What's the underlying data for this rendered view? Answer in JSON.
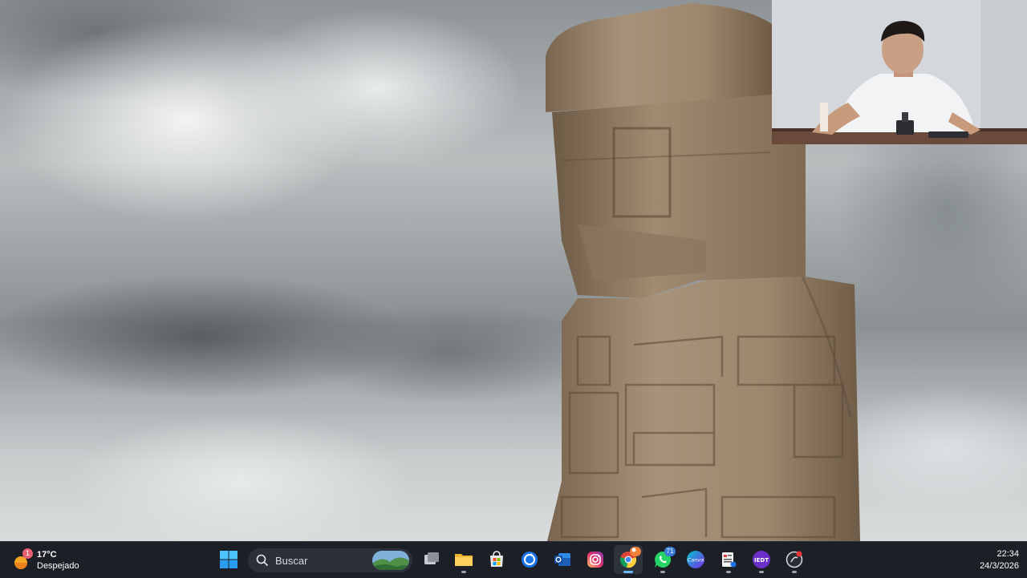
{
  "desktop": {
    "wallpaper": "Stone monolith statue against cloudy sky",
    "overlay": "Webcam feed of presenter"
  },
  "taskbar": {
    "weather": {
      "temperature": "17°C",
      "condition": "Despejado",
      "notification_count": "1",
      "icon": "sun-cloud-icon"
    },
    "start": {
      "icon": "windows-start-icon"
    },
    "search": {
      "placeholder": "Buscar",
      "icon": "search-icon"
    },
    "apps": [
      {
        "name": "task-view",
        "icon": "task-view-icon"
      },
      {
        "name": "file-explorer",
        "icon": "folder-icon"
      },
      {
        "name": "microsoft-store",
        "icon": "store-icon"
      },
      {
        "name": "app-blue-circle",
        "icon": "blue-sync-icon"
      },
      {
        "name": "outlook",
        "icon": "outlook-icon"
      },
      {
        "name": "instagram",
        "icon": "instagram-icon"
      },
      {
        "name": "chrome",
        "icon": "chrome-icon",
        "badge": ""
      },
      {
        "name": "whatsapp",
        "icon": "whatsapp-icon",
        "badge": "71"
      },
      {
        "name": "canva",
        "icon": "canva-icon",
        "label": "Canva"
      },
      {
        "name": "app-document",
        "icon": "document-app-icon"
      },
      {
        "name": "iedt",
        "icon": "iedt-icon",
        "label": "IEDT"
      },
      {
        "name": "app-dark",
        "icon": "dark-app-icon"
      }
    ],
    "clock": {
      "time": "22:34",
      "date": "24/3/2026"
    }
  },
  "colors": {
    "taskbar_bg": "#1c1f26",
    "accent": "#6cb6ff",
    "badge_red": "#e6363a",
    "badge_orange": "#f0803c"
  }
}
